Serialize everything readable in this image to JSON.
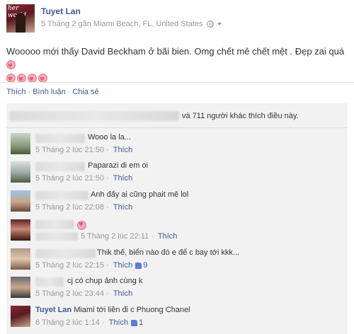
{
  "post": {
    "page_name": "Tuyet Lan",
    "avatar_brand": "her world",
    "timestamp": "5 Tháng 2 gần Miami Beach, FL, United States",
    "text": "Wooooo mới thấy David Beckham ở bãi bien. Omg chết mê chết mệt . Đẹp zai quá",
    "heart_count": 5
  },
  "actions": {
    "like": "Thích",
    "comment": "Bình luận",
    "share": "Chia sẻ",
    "separator": "·"
  },
  "likes": {
    "text": "và 711 người khác thích điều này."
  },
  "comments": [
    {
      "body": "Wooo la la...",
      "time": "5 Tháng 2 lúc 21:50",
      "like_label": "Thích",
      "likes": ""
    },
    {
      "body": "Paparazi di em oi",
      "time": "5 Tháng 2 lúc 21:50",
      "like_label": "Thích",
      "likes": ""
    },
    {
      "body": "Anh đấy ai cũng phait mê lol",
      "time": "5 Tháng 2 lúc 22:08",
      "like_label": "Thích",
      "likes": ""
    },
    {
      "body": "",
      "time": "5 Tháng 2 lúc 22:11",
      "like_label": "Thích",
      "likes": ""
    },
    {
      "body": "Thik thế, biển nào đó e để c bay tới kkk...",
      "time": "5 Tháng 2 lúc 22:15",
      "like_label": "Thích",
      "likes": "9"
    },
    {
      "body": "cj có chụp ảnh cùng k",
      "time": "5 Tháng 2 lúc 23:44",
      "like_label": "Thích",
      "likes": ""
    },
    {
      "name": "Tuyet Lan",
      "body": "Miami tới liền đi c Phuong Chanel",
      "time": "6 Tháng 2 lúc 1:14",
      "like_label": "Thích",
      "likes": "1"
    }
  ],
  "meta_separator": "·",
  "colors": {
    "link": "#3b5998",
    "muted": "#999999",
    "ufi_background": "#f2f2f2"
  }
}
